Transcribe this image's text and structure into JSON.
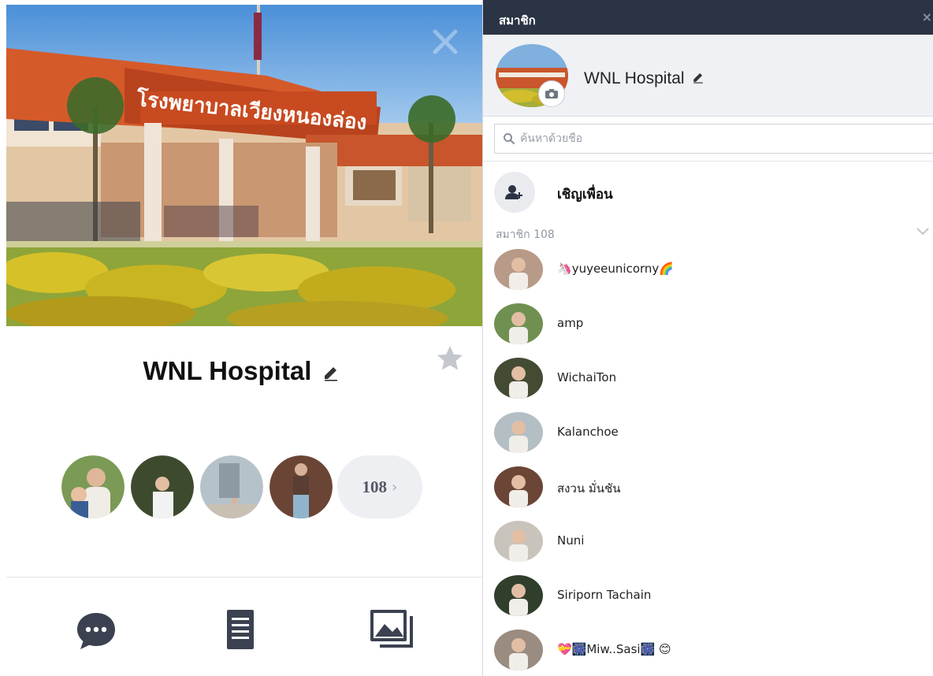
{
  "left_panel": {
    "cover_sign_text": "โรงพยาบาลเวียงหนองล่อง",
    "group_name": "WNL Hospital",
    "member_more_count": "108",
    "member_more_chevron": "›",
    "avatar_colors": [
      "#7a9a56",
      "#3d4a2e",
      "#b6c2c9",
      "#6a4535"
    ],
    "icons": {
      "edit": "pencil-icon",
      "favorite": "star-icon",
      "chat": "chat-bubble-icon",
      "notes": "note-list-icon",
      "album": "photo-album-icon",
      "cover_close": "close-icon"
    }
  },
  "right_panel": {
    "header_title": "สมาชิก",
    "close_glyph": "×",
    "group_name": "WNL Hospital",
    "search": {
      "placeholder": "ค้นหาด้วยชื่อ"
    },
    "invite_label": "เชิญเพื่อน",
    "members_count_label": "สมาชิก 108",
    "members": [
      {
        "prefix": "🦄",
        "name": "yuyeeunicorny",
        "suffix": "🌈",
        "color": "#b89a88"
      },
      {
        "prefix": "",
        "name": "amp",
        "suffix": "",
        "color": "#6f9050"
      },
      {
        "prefix": "",
        "name": "WichaiTon",
        "suffix": "",
        "color": "#434b33"
      },
      {
        "prefix": "",
        "name": "Kalanchoe",
        "suffix": "",
        "color": "#b4bec5"
      },
      {
        "prefix": "",
        "name": "สงวน มั่นชัน",
        "suffix": "",
        "color": "#6b4536"
      },
      {
        "prefix": "",
        "name": "Nuni",
        "suffix": "",
        "color": "#c9c4bb"
      },
      {
        "prefix": "",
        "name": "Siriporn Tachain",
        "suffix": "",
        "color": "#2f3f2b"
      },
      {
        "prefix": "💝🎆",
        "name": "Miw..Sasi",
        "suffix": "🎆 😊",
        "color": "#9a8c80"
      }
    ]
  },
  "colors": {
    "header_bg": "#2b3444",
    "group_head_bg": "#eff1f4",
    "icon_dark": "#3b4150",
    "muted_text": "#9097a2"
  }
}
